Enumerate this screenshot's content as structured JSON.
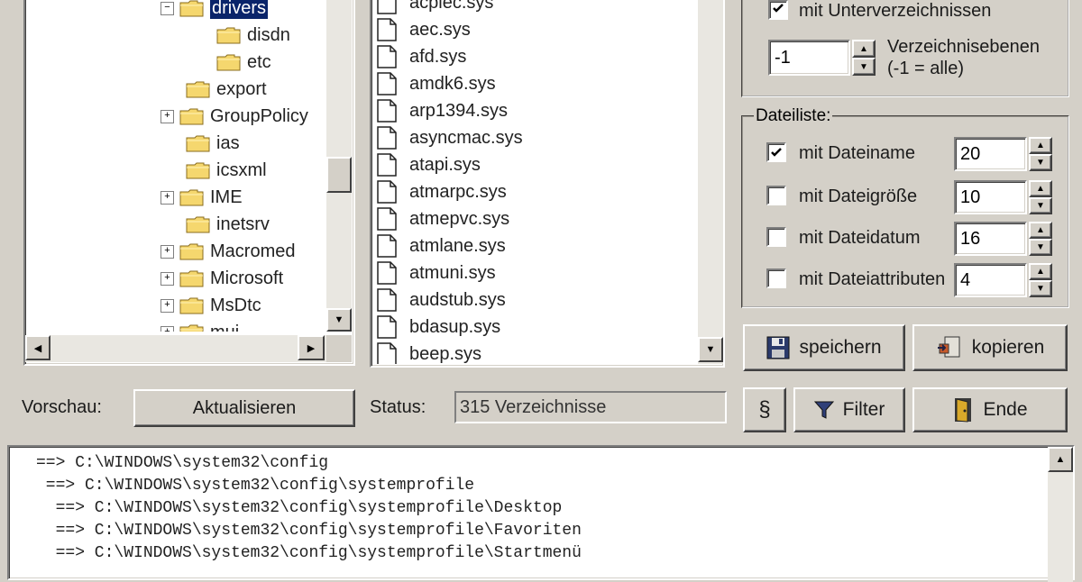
{
  "tree": {
    "items": [
      {
        "label": "drivers",
        "expander": "⊟",
        "selected": true
      },
      {
        "label": "disdn",
        "expander": "",
        "selected": false
      },
      {
        "label": "etc",
        "expander": "",
        "selected": false
      },
      {
        "label": "export",
        "expander": "",
        "selected": false
      },
      {
        "label": "GroupPolicy",
        "expander": "⊞",
        "selected": false
      },
      {
        "label": "ias",
        "expander": "",
        "selected": false
      },
      {
        "label": "icsxml",
        "expander": "",
        "selected": false
      },
      {
        "label": "IME",
        "expander": "⊞",
        "selected": false
      },
      {
        "label": "inetsrv",
        "expander": "",
        "selected": false
      },
      {
        "label": "Macromed",
        "expander": "⊞",
        "selected": false
      },
      {
        "label": "Microsoft",
        "expander": "⊞",
        "selected": false
      },
      {
        "label": "MsDtc",
        "expander": "⊞",
        "selected": false
      },
      {
        "label": "mui",
        "expander": "⊞",
        "selected": false
      }
    ]
  },
  "files": {
    "items": [
      "acpiec.sys",
      "aec.sys",
      "afd.sys",
      "amdk6.sys",
      "arp1394.sys",
      "asyncmac.sys",
      "atapi.sys",
      "atmarpc.sys",
      "atmepvc.sys",
      "atmlane.sys",
      "atmuni.sys",
      "audstub.sys",
      "bdasup.sys",
      "beep.sys"
    ]
  },
  "options": {
    "subdirs_label": "mit Unterverzeichnissen",
    "subdirs_checked": true,
    "levels_value": "-1",
    "levels_label_line1": "Verzeichnisebenen",
    "levels_label_line2": "(-1 = alle)"
  },
  "filelist_group": {
    "title": "Dateiliste:",
    "rows": [
      {
        "label": "mit Dateiname",
        "checked": true,
        "value": "20"
      },
      {
        "label": "mit Dateigröße",
        "checked": false,
        "value": "10"
      },
      {
        "label": "mit Dateidatum",
        "checked": false,
        "value": "16"
      },
      {
        "label": "mit Dateiattributen",
        "checked": false,
        "value": "4"
      }
    ]
  },
  "buttons": {
    "save": "speichern",
    "copy": "kopieren",
    "filter": "Filter",
    "end": "Ende",
    "refresh": "Aktualisieren",
    "help_glyph": "§"
  },
  "preview_label": "Vorschau:",
  "status_label": "Status:",
  "status_value": "315 Verzeichnisse",
  "output": {
    "lines": [
      "==> C:\\WINDOWS\\system32\\config",
      " ==> C:\\WINDOWS\\system32\\config\\systemprofile",
      "  ==> C:\\WINDOWS\\system32\\config\\systemprofile\\Desktop",
      "  ==> C:\\WINDOWS\\system32\\config\\systemprofile\\Favoriten",
      "  ==> C:\\WINDOWS\\system32\\config\\systemprofile\\Startmenü"
    ]
  },
  "colors": {
    "face": "#d4d0c8",
    "selection": "#0a246a",
    "folder": "#f5d76e"
  }
}
